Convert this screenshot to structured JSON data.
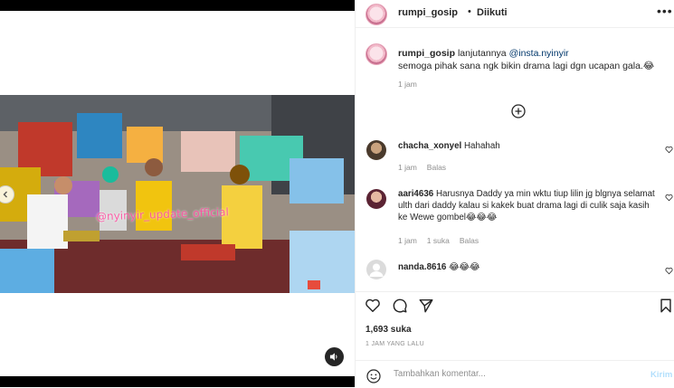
{
  "post": {
    "username": "rumpi_gosip",
    "follow_separator": "•",
    "follow_status": "Diikuti",
    "more_icon": "more-horizontal-icon",
    "video_watermark": "@nyinyir_update_official",
    "caption": {
      "username": "rumpi_gosip",
      "text_before": "lanjutannya",
      "mention": "@insta.nyinyir",
      "line2": "semoga pihak sana ngk bikin drama lagi dgn ucapan gala.",
      "emoji": "😂",
      "time": "1 jam"
    },
    "likes": "1,693 suka",
    "posted_ago": "1 JAM YANG LALU"
  },
  "comments": [
    {
      "username": "chacha_xonyel",
      "text": "Hahahah",
      "time": "1 jam",
      "reply": "Balas",
      "likes": ""
    },
    {
      "username": "aari4636",
      "text": "Harusnya Daddy ya min wktu tiup lilin jg blgnya selamat ulth dari daddy kalau si kakek buat drama lagi di culik saja kasih ke Wewe gombel",
      "emoji": "😂😂😂",
      "time": "1 jam",
      "likes": "1 suka",
      "reply": "Balas"
    },
    {
      "username": "nanda.8616",
      "text": "",
      "emoji": "😂😂😂",
      "time": "",
      "reply": "",
      "likes": ""
    }
  ],
  "add_comment": {
    "placeholder": "Tambahkan komentar...",
    "post_label": "Kirim"
  },
  "colors": {
    "accent": "#0095f6",
    "post_disabled": "#b2dffc",
    "watermark": "#ff4fa1",
    "muted_text": "#8e8e8e"
  }
}
